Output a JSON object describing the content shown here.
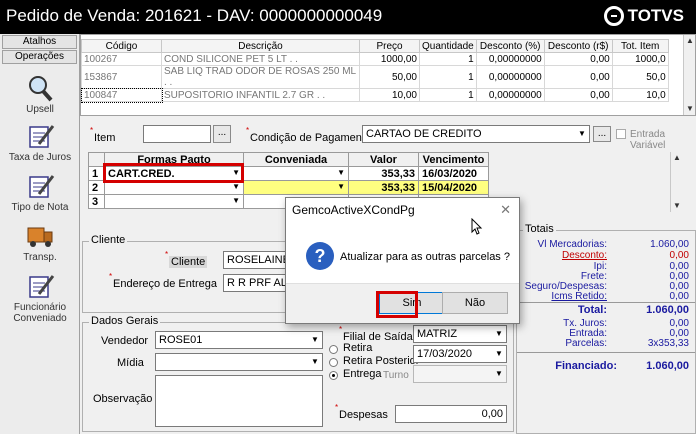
{
  "window": {
    "title": "Pedido de Venda: 201621  - DAV: 0000000000049",
    "brand": "TOTVS"
  },
  "sidebar": {
    "tabs": [
      "Atalhos",
      "Operações"
    ],
    "items": [
      {
        "label": "Upsell",
        "icon": "magnifier-icon"
      },
      {
        "label": "Taxa de Juros",
        "icon": "notepad-pencil-icon"
      },
      {
        "label": "Tipo de Nota",
        "icon": "notepad-pencil-icon"
      },
      {
        "label": "Transp.",
        "icon": "truck-icon"
      },
      {
        "label": "Funcionário Conveniado",
        "icon": "notepad-pencil-icon"
      }
    ]
  },
  "items_grid": {
    "headers": [
      "Código",
      "Descrição",
      "Preço",
      "Quantidade",
      "Desconto (%)",
      "Desconto (r$)",
      "Tot. Item"
    ],
    "rows": [
      [
        "100267",
        "COND SILICONE PET 5 LT . .",
        "1000,00",
        "1",
        "0,00000000",
        "0,00",
        "1000,0"
      ],
      [
        "153867",
        "SAB LIQ TRAD ODOR DE ROSAS 250 ML  . .",
        "50,00",
        "1",
        "0,00000000",
        "0,00",
        "50,0"
      ],
      [
        "100847",
        "SUPOSITORIO INFANTIL 2.7 GR . .",
        "10,00",
        "1",
        "0,00000000",
        "0,00",
        "10,0"
      ]
    ]
  },
  "form": {
    "item_label": "Item",
    "item_btn": "...",
    "cond_label": "Condição de Pagamento",
    "cond_value": "CARTAO DE CREDITO",
    "cond_btn": "...",
    "entrada_label": "Entrada Variável"
  },
  "parcelas": {
    "headers": [
      "Formas Pagto",
      "Conveniada",
      "Valor",
      "Vencimento"
    ],
    "rows": [
      {
        "n": "1",
        "forma": "CART.CRED.",
        "conv": "",
        "valor": "353,33",
        "venc": "16/03/2020"
      },
      {
        "n": "2",
        "forma": "",
        "conv": "",
        "valor": "353,33",
        "venc": "15/04/2020"
      },
      {
        "n": "3",
        "forma": "",
        "conv": "",
        "valor": "",
        "venc": ""
      }
    ]
  },
  "cliente": {
    "title": "Cliente",
    "cliente_label": "Cliente",
    "cliente_value": "ROSELAINE",
    "endereco_label": "Endereço de Entrega",
    "endereco_value": "R  R PRF ALV"
  },
  "dados": {
    "title": "Dados Gerais",
    "vendedor_label": "Vendedor",
    "vendedor_value": "ROSE01",
    "midia_label": "Mídia",
    "midia_value": "",
    "obs_label": "Observação",
    "filial_label": "Filial de Saída",
    "filial_value": "MATRIZ",
    "retira_label": "Retira",
    "retira_post_label": "Retira Posterior",
    "retira_post_date": "17/03/2020",
    "entrega_label": "Entrega",
    "turno_label": "Turno",
    "despesas_label": "Despesas",
    "despesas_value": "0,00"
  },
  "totais": {
    "title": "Totais",
    "rows": [
      {
        "k": "Vl Mercadorias:",
        "v": "1.060,00"
      },
      {
        "k": "Desconto:",
        "v": "0,00"
      },
      {
        "k": "Ipi:",
        "v": "0,00"
      },
      {
        "k": "Frete:",
        "v": "0,00"
      },
      {
        "k": "Seguro/Despesas:",
        "v": "0,00"
      },
      {
        "k": "Icms Retido:",
        "v": "0,00"
      }
    ],
    "total_label": "Total:",
    "total_value": "1.060,00",
    "rows2": [
      {
        "k": "Tx. Juros:",
        "v": "0,00"
      },
      {
        "k": "Entrada:",
        "v": "0,00"
      },
      {
        "k": "Parcelas:",
        "v": "3x353,33"
      }
    ],
    "financiado_label": "Financiado:",
    "financiado_value": "1.060,00"
  },
  "dialog": {
    "title": "GemcoActiveXCondPg",
    "message": "Atualizar para as outras parcelas ?",
    "yes": "Sim",
    "no": "Não"
  },
  "colors": {
    "highlight_yellow": "#ffff80",
    "red_outline": "#d40000",
    "totals_text": "#1a1aa0"
  }
}
